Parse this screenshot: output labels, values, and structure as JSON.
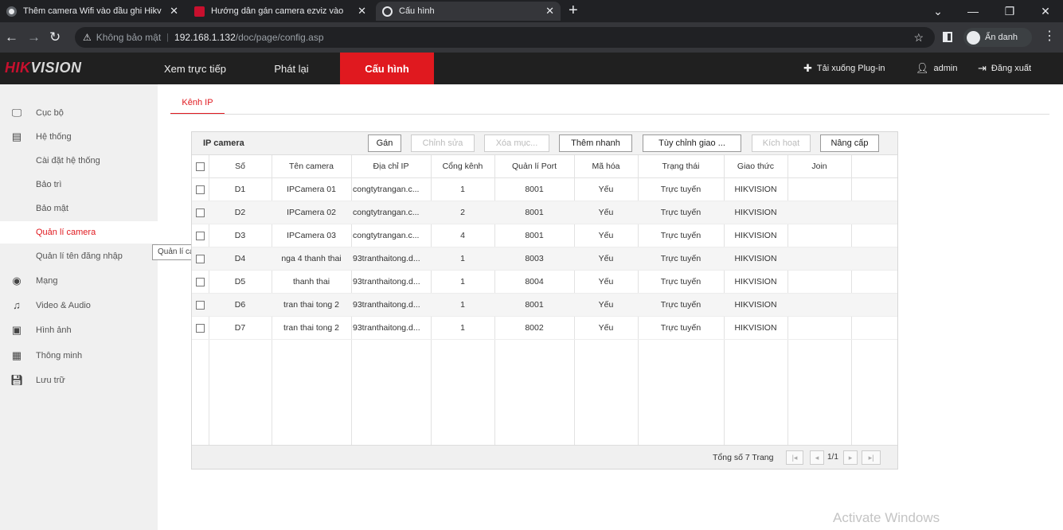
{
  "browser": {
    "tabs": [
      {
        "label": "Thêm camera Wifi vào đầu ghi Hikv",
        "favicon_color": "#ffffff"
      },
      {
        "label": "Hướng dẫn gán camera ezviz vào",
        "favicon_color": "#c8102e"
      },
      {
        "label": "Cấu hình",
        "favicon_color": "#e8eaed"
      }
    ],
    "address": {
      "security": "Không bảo mật",
      "host": "192.168.1.132",
      "path": "/doc/page/config.asp"
    },
    "profile_label": "Ẩn danh"
  },
  "app": {
    "logo_part1": "HIK",
    "logo_part2": "VISION",
    "nav": [
      "Xem trực tiếp",
      "Phát lại",
      "Cấu hình"
    ],
    "active_nav": "Cấu hình",
    "header_right": {
      "plugin": "Tải xuống Plug-in",
      "user": "admin",
      "logout": "Đăng xuất"
    }
  },
  "sidebar": {
    "items": [
      {
        "label": "Cục bộ",
        "icon": "monitor-icon"
      },
      {
        "label": "Hệ thống",
        "icon": "system-icon"
      },
      {
        "label": "Cài đặt hệ thống",
        "icon": ""
      },
      {
        "label": "Bảo trì",
        "icon": ""
      },
      {
        "label": "Bảo mật",
        "icon": ""
      },
      {
        "label": "Quản lí camera",
        "icon": ""
      },
      {
        "label": "Quản lí tên đăng nhập",
        "icon": ""
      },
      {
        "label": "Mạng",
        "icon": "globe-icon"
      },
      {
        "label": "Video & Audio",
        "icon": "audio-video-icon"
      },
      {
        "label": "Hình ảnh",
        "icon": "image-icon"
      },
      {
        "label": "Thông minh",
        "icon": "smart-icon"
      },
      {
        "label": "Lưu trữ",
        "icon": "storage-icon"
      }
    ],
    "active": "Quản lí camera",
    "tooltip": "Quản lí camera"
  },
  "content": {
    "subtab": "Kênh IP",
    "panel_title": "IP camera",
    "toolbar": {
      "add": "Gán",
      "edit": "Chỉnh sửa",
      "delete": "Xóa mục...",
      "quick_add": "Thêm nhanh",
      "custom_protocol": "Tùy chỉnh giao ...",
      "activate": "Kích hoạt",
      "upgrade": "Nâng cấp"
    },
    "columns": [
      "Số",
      "Tên camera",
      "Địa chỉ IP",
      "Cổng kênh",
      "Quản lí Port",
      "Mã hóa",
      "Trạng thái",
      "Giao thức",
      "Join"
    ],
    "rows": [
      [
        "D1",
        "IPCamera 01",
        "congtytrangan.c...",
        "1",
        "8001",
        "Yếu",
        "Trực tuyến",
        "HIKVISION",
        ""
      ],
      [
        "D2",
        "IPCamera 02",
        "congtytrangan.c...",
        "2",
        "8001",
        "Yếu",
        "Trực tuyến",
        "HIKVISION",
        ""
      ],
      [
        "D3",
        "IPCamera 03",
        "congtytrangan.c...",
        "4",
        "8001",
        "Yếu",
        "Trực tuyến",
        "HIKVISION",
        ""
      ],
      [
        "D4",
        "nga 4 thanh thai",
        "93tranthaitong.d...",
        "1",
        "8003",
        "Yếu",
        "Trực tuyến",
        "HIKVISION",
        ""
      ],
      [
        "D5",
        "thanh thai",
        "93tranthaitong.d...",
        "1",
        "8004",
        "Yếu",
        "Trực tuyến",
        "HIKVISION",
        ""
      ],
      [
        "D6",
        "tran thai tong 2",
        "93tranthaitong.d...",
        "1",
        "8001",
        "Yếu",
        "Trực tuyến",
        "HIKVISION",
        ""
      ],
      [
        "D7",
        "tran thai tong 2",
        "93tranthaitong.d...",
        "1",
        "8002",
        "Yếu",
        "Trực tuyến",
        "HIKVISION",
        ""
      ]
    ],
    "footer": {
      "total": "Tổng số 7 Trang",
      "page": "1/1"
    }
  },
  "watermark": "Activate Windows",
  "colors": {
    "accent": "#e0191f",
    "header_bg": "#202020",
    "sidebar_bg": "#f0f0f0"
  }
}
